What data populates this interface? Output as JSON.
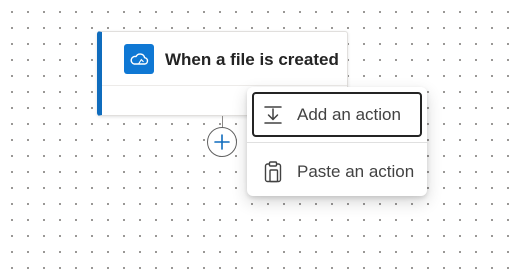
{
  "trigger": {
    "title": "When a file is created",
    "service_icon": "onedrive-cloud-icon",
    "accent_color": "#0f6cbd"
  },
  "connector": {
    "add_icon": "plus-icon"
  },
  "menu": {
    "items": [
      {
        "label": "Add an action",
        "icon": "add-action-icon",
        "focused": true
      },
      {
        "label": "Paste an action",
        "icon": "clipboard-icon",
        "focused": false
      }
    ]
  }
}
